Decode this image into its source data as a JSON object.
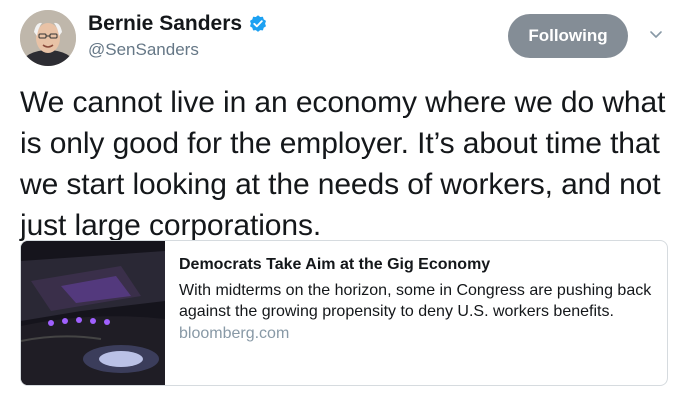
{
  "tweet": {
    "author": {
      "display_name": "Bernie Sanders",
      "handle": "@SenSanders",
      "avatar_icon": "avatar-photo",
      "verified_icon": "verified-badge-icon",
      "verified_color": "#1da1f2"
    },
    "follow_button_label": "Following",
    "menu_icon": "chevron-down-icon",
    "text": "We cannot live in an economy where we do what is only good for the employer. It’s about time that we start looking at the needs of workers, and not just large corporations."
  },
  "card": {
    "image_icon": "car-interior-photo",
    "title": "Democrats Take Aim at the Gig Economy",
    "description": "With midterms on the horizon, some in Congress are pushing back against the growing propensity to deny U.S. workers benefits.",
    "domain": "bloomberg.com"
  },
  "colors": {
    "button_bg": "#848d96",
    "text_primary": "#14171a",
    "text_secondary": "#657786",
    "border": "#d6dbdf"
  }
}
